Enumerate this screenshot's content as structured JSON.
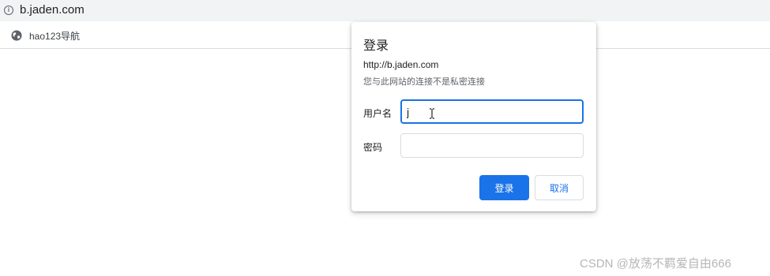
{
  "browser": {
    "url": "b.jaden.com",
    "bookmarks": [
      {
        "label": "hao123导航",
        "icon": "globe-icon"
      }
    ]
  },
  "auth_dialog": {
    "title": "登录",
    "origin": "http://b.jaden.com",
    "warning": "您与此网站的连接不是私密连接",
    "username_label": "用户名",
    "username_value": "j",
    "password_label": "密码",
    "password_value": "",
    "login_button": "登录",
    "cancel_button": "取消"
  },
  "watermark": "CSDN @放荡不羁爱自由666",
  "colors": {
    "accent": "#1a73e8",
    "toolbar": "#f1f3f4",
    "border": "#dadce0"
  }
}
